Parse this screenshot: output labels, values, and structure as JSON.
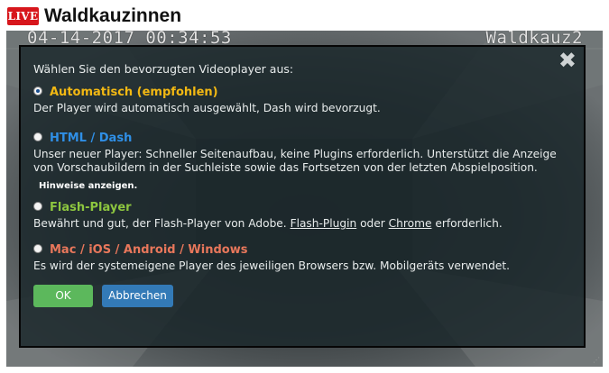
{
  "header": {
    "live_badge": "LIVE",
    "title": "Waldkauzinnen"
  },
  "player": {
    "osd_timestamp": "04-14-2017 00:34:53",
    "osd_camera": "Waldkauz2"
  },
  "dialog": {
    "close_symbol": "✖",
    "intro": "Wählen Sie den bevorzugten Videoplayer aus:",
    "options": [
      {
        "title": "Automatisch (empfohlen)",
        "color": "#f2b813",
        "selected": true,
        "description": "Der Player wird automatisch ausgewählt, Dash wird bevorzugt."
      },
      {
        "title": "HTML / Dash",
        "color": "#2f8fe6",
        "selected": false,
        "description": "Unser neuer Player: Schneller Seitenaufbau, keine Plugins erforderlich. Unterstützt die Anzeige von Vorschaubildern in der Suchleiste sowie das Fortsetzen von der letzten Abspielposition.",
        "hint_link": "Hinweise anzeigen."
      },
      {
        "title": "Flash-Player",
        "color": "#8dc63f",
        "selected": false,
        "description_prefix": "Bewährt und gut, der Flash-Player von Adobe.",
        "link_flash": "Flash-Plugin",
        "description_middle": "oder",
        "link_chrome": "Chrome",
        "description_suffix": "erforderlich."
      },
      {
        "title": "Mac / iOS / Android / Windows",
        "color": "#e8775b",
        "selected": false,
        "description": "Es wird der systemeigene Player des jeweiligen Browsers bzw. Mobilgeräts verwendet."
      }
    ],
    "ok_label": "OK",
    "cancel_label": "Abbrechen"
  },
  "colors": {
    "live_red": "#d7161c",
    "ok_green": "#5cb85c",
    "cancel_blue": "#337ab7"
  }
}
